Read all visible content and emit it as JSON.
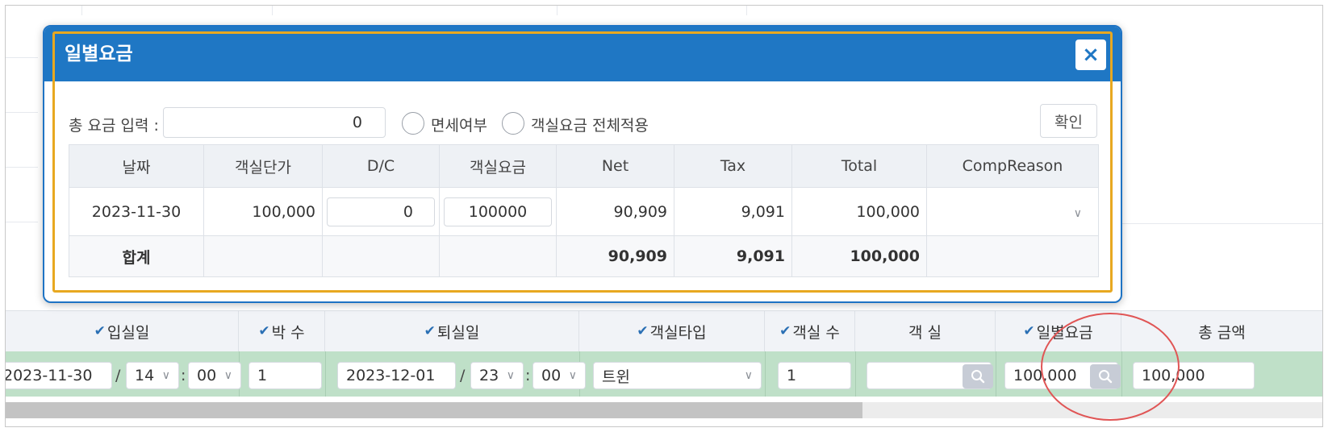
{
  "reservation": {
    "headers": [
      {
        "label": "입실일",
        "checked": true
      },
      {
        "label": "박 수",
        "checked": true
      },
      {
        "label": "퇴실일",
        "checked": true
      },
      {
        "label": "객실타입",
        "checked": true
      },
      {
        "label": "객실 수",
        "checked": true
      },
      {
        "label": "객 실",
        "checked": false
      },
      {
        "label": "일별요금",
        "checked": true
      },
      {
        "label": "총 금액",
        "checked": false
      }
    ],
    "checkin_date": "2023-11-30",
    "checkin_hour": "14",
    "checkin_minute": "00",
    "nights": "1",
    "checkout_date": "2023-12-01",
    "checkout_hour": "23",
    "checkout_minute": "00",
    "room_type": "트윈",
    "room_count": "1",
    "room": "",
    "daily_rate": "100,000",
    "total_amount": "100,000",
    "date_sep": "/",
    "time_sep": ":"
  },
  "modal": {
    "title": "일별요금",
    "close_symbol": "×",
    "total_input_label": "총 요금 입력 :",
    "total_input_value": "0",
    "tax_exempt_label": "면세여부",
    "apply_all_label": "객실요금 전체적용",
    "confirm_label": "확인",
    "table": {
      "headers": [
        "날짜",
        "객실단가",
        "D/C",
        "객실요금",
        "Net",
        "Tax",
        "Total",
        "CompReason"
      ],
      "row": {
        "date": "2023-11-30",
        "unit_price": "100,000",
        "dc": "0",
        "room_rate": "100000",
        "net": "90,909",
        "tax": "9,091",
        "total": "100,000",
        "comp_reason": ""
      },
      "sum": {
        "label": "합계",
        "net": "90,909",
        "tax": "9,091",
        "total": "100,000"
      }
    }
  },
  "colors": {
    "modal_header": "#1f77c4",
    "row_highlight": "#bfe0c8",
    "focus_outline": "#e8a820",
    "annotation_circle": "#e05555"
  }
}
